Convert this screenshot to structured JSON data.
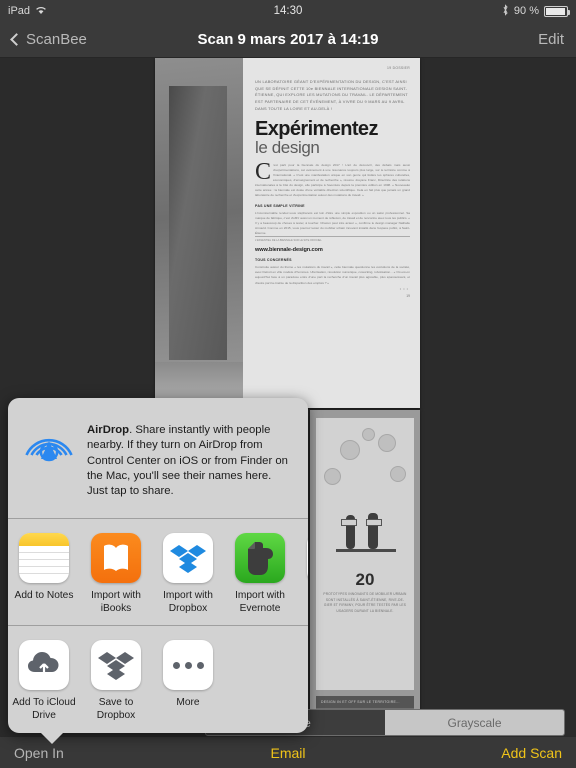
{
  "status_bar": {
    "device": "iPad",
    "wifi_icon": "wifi-icon",
    "time": "14:30",
    "bluetooth_icon": "bluetooth-icon",
    "battery_text": "90 %",
    "battery_percent": 90
  },
  "nav_bar": {
    "back_label": "ScanBee",
    "title": "Scan 9 mars 2017 à 14:19",
    "edit_label": "Edit"
  },
  "document": {
    "page1": {
      "folio": "19  DOSSIER",
      "kicker": "UN LABORATOIRE GÉANT D'EXPÉRIMENTATION DU DESIGN, C'EST AINSI QUE SE DÉFINIT CETTE 10e BIENNALE INTERNATIONALE DESIGN SAINT-ÉTIENNE, QUI EXPLORE LES MUTATIONS DU TRAVAIL. LE DÉPARTEMENT EST PARTENAIRE DE CET ÉVÉNEMENT, À VIVRE DU 9 MARS AU 9 AVRIL DANS TOUTE LA LOIRE ET AU-DELÀ !",
      "headline": "Expérimentez",
      "subhead": "le design",
      "dropcap": "C",
      "body1": "'est parti pour la biennale du design 2017 ! L'art de découvrir, des débats mais aussi d'expérimentations, cet événement à une résonance toujours plus large, sur le territoire comme à l'international. « C'est une manifestation unique en son genre qui fédère les sphères culturelles, économiques, d'enseignement et de recherche », résume Josyane Franc, Directrice des relations internationales à la Cité du design, elle participe à l'aventure depuis la première édition en 1998. « Nouveauté cette année : la biennale est dotée d'une véritable direction scientifique. Cela en fait plus que jamais un grand laboratoire de recherche et d'expérimentation autour des mutations du travail. »",
      "sub1": "PAS UNE SIMPLE VITRINE",
      "body2": "L'incontournable rendez-vous stéphanois est loin d'être une simple exposition ou un salon professionnel. Sa marque de fabrique, c'est d'offrir aussi un moment de réflexion, de travail et de rencontre avec tous les publics. « Il y a beaucoup de choses à tester, à toucher. Chacun peut être acteur », confirme le design manager Nathalie Arnould. Comme en 2015, vous pourrez tester du mobilier urbain innovant installé dans l'espace public, à Saint-Étienne.",
      "url": "www.biennale-design.com",
      "url_caption": "L'ESSENTIEL DE LA BIENNALE SUR LE SITE OFFICIEL",
      "sub2": "TOUS CONCERNÉS",
      "body3": "Construite autour du thème « les mutations du travail », cette biennale questionne les évolutions de la société, avec Detroit en ville modèle d'hommes. Ubérisation, révolution numérique, coworking, robotisation... « Où est-on aujourd'hui face à un paradoxe entre d'une part la recherche d'un travail plus agréable, plus épanouissant, et d'autre part la crainte de la disparition des emplois ? »",
      "page_number": "19"
    },
    "page2": {
      "number": "20",
      "caption": "PROTOTYPES INNOVANTS DE MOBILIER URBAIN SONT INSTALLÉS À SAINT-ÉTIENNE, RIVE-DE-GIER ET FIRMINY, POUR ÊTRE TESTÉS PAR LES USAGERS DURANT LA BIENNALE.",
      "banner": "DESIGN IN ET OFF SUR LE TERRITOIRE..."
    }
  },
  "segmented_control": {
    "options": [
      "White",
      "Grayscale"
    ],
    "selected": "Grayscale"
  },
  "toolbar": {
    "open_in": "Open In",
    "email": "Email",
    "add_scan": "Add Scan",
    "accent_color": "#f0c419"
  },
  "share_sheet": {
    "airdrop": {
      "icon": "airdrop-icon",
      "title": "AirDrop",
      "description": ". Share instantly with people nearby. If they turn on AirDrop from Control Center on iOS or from Finder on the Mac, you'll see their names here. Just tap to share.",
      "icon_color": "#2b88f0"
    },
    "apps": [
      {
        "label": "Add to Notes",
        "icon": "notes-icon"
      },
      {
        "label": "Import with iBooks",
        "icon": "ibooks-icon"
      },
      {
        "label": "Import with Dropbox",
        "icon": "dropbox-icon"
      },
      {
        "label": "Import with Evernote",
        "icon": "evernote-icon"
      },
      {
        "label": "",
        "icon": "more-apps-icon"
      }
    ],
    "actions": [
      {
        "label": "Add To iCloud Drive",
        "icon": "icloud-upload-icon"
      },
      {
        "label": "Save to Dropbox",
        "icon": "dropbox-grey-icon"
      },
      {
        "label": "More",
        "icon": "more-icon"
      }
    ]
  }
}
